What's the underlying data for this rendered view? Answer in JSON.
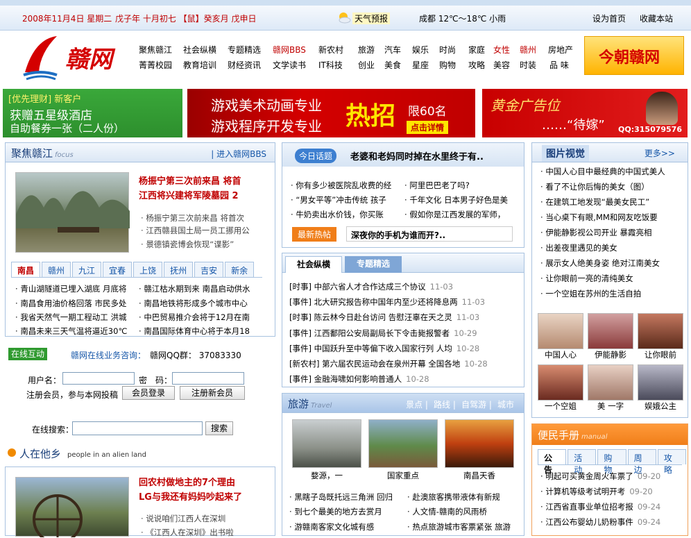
{
  "top": {
    "date": "2008年11月4日 星期二",
    "lunar": "戊子年 十月初七 【鼠】癸亥月 戊申日",
    "weather_label": "天气预报",
    "weather_text": "成都 12℃～18℃ 小雨",
    "homepage": "设为首页",
    "bookmark": "收藏本站"
  },
  "logo_text": "赣网",
  "nav_row1": [
    "聚焦赣江",
    "社会纵横",
    "专题精选",
    "赣网BBS",
    "新农村",
    "旅游",
    "汽车",
    "娱乐",
    "时尚",
    "家庭",
    "女性",
    "赣州",
    "房地产"
  ],
  "nav_row2": [
    "菁菁校园",
    "教育培训",
    "财经资讯",
    "文学读书",
    "IT科技",
    "创业",
    "美食",
    "星座",
    "购物",
    "攻略",
    "美容",
    "时装",
    "品 味"
  ],
  "today_logo": "今朝赣网",
  "ad1": {
    "l1": "[优先理财] 新客户",
    "l2": "获赠五星级酒店",
    "l3": "自助餐券一张（二人份）"
  },
  "ad2": {
    "l1": "游戏美术动画专业",
    "l2": "游戏程序开发专业",
    "hot": "热招",
    "limit": "限60名",
    "detail": "点击详情"
  },
  "ad3": {
    "l1": "黄金广告位",
    "l2": "……“待嫁”",
    "qq": "QQ:315079576"
  },
  "focus": {
    "title": "聚焦赣江",
    "sub": "focus",
    "more": "进入赣网BBS",
    "headline1": "杨振宁第三次前来昌 将首",
    "headline2": "江西将兴建将军陵墓园 2",
    "items": [
      "杨振宁第三次前来昌 将首次",
      "江西赣县国土局一员工挪用公",
      "景德镇瓷博会恢现“谍影”"
    ]
  },
  "city_tabs": [
    "南昌",
    "赣州",
    "九江",
    "宜春",
    "上饶",
    "抚州",
    "吉安",
    "新余"
  ],
  "city_news": [
    [
      "青山湖隧道已埋入湖底 月底将",
      "赣江枯水期到来 南昌启动供水"
    ],
    [
      "南昌食用油价格回落 市民多处",
      "南昌地铁将形成多个城市中心"
    ],
    [
      "我省天然气一期工程动工 洪城",
      "中巴贸易推介会将于12月在南"
    ],
    [
      "南昌未来三天气温将逼近30℃",
      "南昌国际体育中心将于本月18"
    ]
  ],
  "online": {
    "badge": "在线互动",
    "service": "赣网在线业务咨询：",
    "qq": "赣网QQ群： 37083330",
    "user_label": "用户名：",
    "pass_label": "密　码：",
    "register_text": "注册会员，参与本网投稿",
    "login": "会员登录",
    "reg": "注册新会员",
    "search_label": "在线搜索：",
    "search_btn": "搜索"
  },
  "alien": {
    "title": "人在他乡",
    "sub": "people in an alien land",
    "h1": "回农村做地主的7个理由",
    "h2": "LG与我还有妈妈吵起来了",
    "items": [
      "说说咱们江西人在深圳",
      "《江西人在深圳》出书啦"
    ]
  },
  "topic": {
    "label": "今日话题",
    "title": "老婆和老妈同时掉在水里终于有..",
    "items": [
      [
        "你有多少被医院乱收费的经",
        "阿里巴巴老了吗?"
      ],
      [
        "“男女平等”冲击传统 孩子",
        "千年文化 日本男子好色是美"
      ],
      [
        "牛奶卖出水价钱，你买账",
        "假如你是江西发展的军师，"
      ]
    ],
    "hot_label": "最新热帖",
    "hot_title": "深夜你的手机为谁而开?.."
  },
  "news_tabs": [
    "社会纵横",
    "专题精选"
  ],
  "news": [
    [
      "[时事]",
      "中部六省人才合作达成三个协议",
      "11-03"
    ],
    [
      "[事件]",
      "北大研究报告称中国年内至少还将降息两",
      "11-03"
    ],
    [
      "[时事]",
      "陈云林今日赴台访问 告慰汪辜在天之灵",
      "11-03"
    ],
    [
      "[事件]",
      "江西鄱阳公安局副局长下令击毙报警者",
      "10-29"
    ],
    [
      "[事件]",
      "中国跃升至中等偏下收入国家行列 人均",
      "10-28"
    ],
    [
      "[新农村]",
      "第六届农民运动会在泉州开幕 全国各地",
      "10-28"
    ],
    [
      "[事件]",
      "金融海啸如何影响普通人",
      "10-28"
    ]
  ],
  "travel": {
    "title": "旅游",
    "sub": "Travel",
    "links": [
      "景点",
      "路线",
      "自驾游",
      "城市"
    ],
    "captions": [
      "婺源，一",
      "国家重点",
      "南昌天香"
    ],
    "items": [
      [
        "黑瞎子岛既托远三角洲 回归",
        "赴澳旅客携带液体有新规"
      ],
      [
        "到七个最美的地方去赏月",
        "人文情-赣南的风雨桥"
      ],
      [
        "游赣南客家文化城有感",
        "热点旅游城市客票紧张 旅游"
      ]
    ]
  },
  "photo": {
    "title": "图片视觉",
    "more": "更多>>",
    "items": [
      "中国人心目中最经典的中国式美人",
      "看了不让你后悔的美女（图）",
      "在建筑工地发现“最美女民工”",
      "当心桌下有眼,MM和网友吃饭要",
      "伊能静影视公司开业 暴霞亮相",
      "出差夜里遇见的美女",
      "展示女人绝美身姿 绝对江南美女",
      "让你眼前一亮的清纯美女",
      "一个空姐在苏州的生活自拍"
    ],
    "captions": [
      "中国人心",
      "伊能静影",
      "让你眼前",
      "一个空姐",
      "美 一字",
      "娱娥公主"
    ]
  },
  "bianmin": {
    "title": "便民手册",
    "sub": "manual",
    "tabs": [
      "公告",
      "活动",
      "购物",
      "周边",
      "攻略"
    ],
    "items": [
      [
        "明起可买黄金周火车票了",
        "09-20"
      ],
      [
        "计算机等级考试明开考",
        "09-20"
      ],
      [
        "江西省直事业单位招考报",
        "09-24"
      ],
      [
        "江西公布婴幼儿奶粉事件",
        "09-24"
      ]
    ]
  },
  "colors": {
    "brand_blue": "#1a3f7a",
    "red": "#c00000",
    "nav_red": "#c00000",
    "bianmin_orange": "#f07e19"
  }
}
